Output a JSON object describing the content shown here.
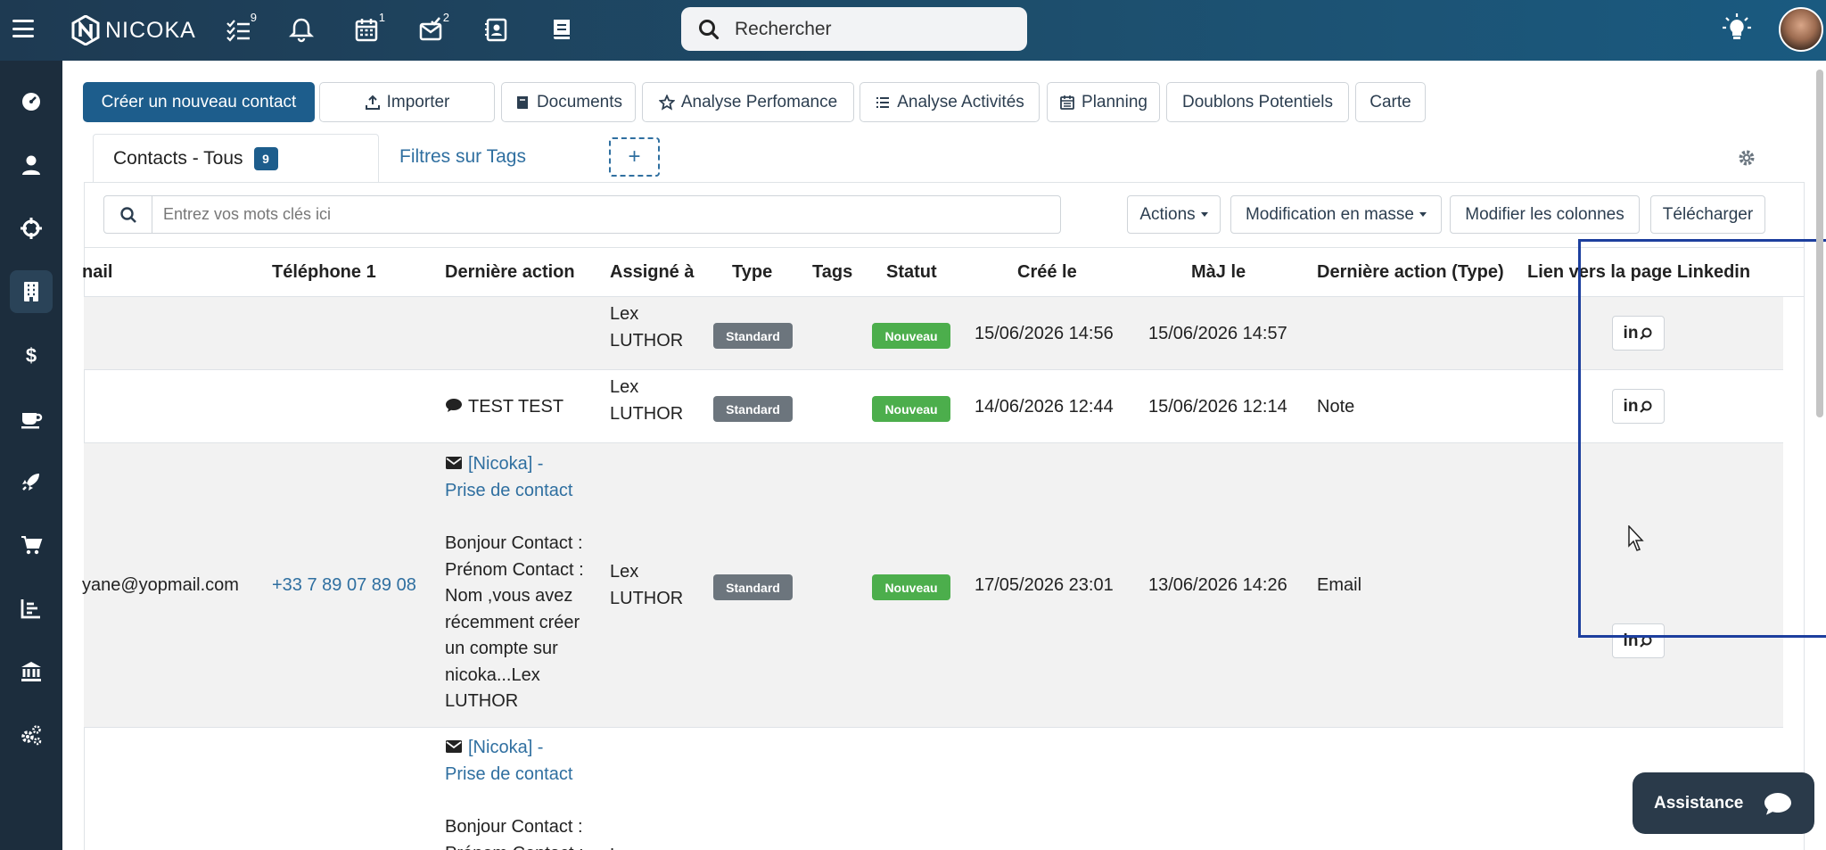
{
  "app": {
    "logo": "NICOKA"
  },
  "topbar": {
    "badges": {
      "tasks": "9",
      "calendar": "1",
      "mail": "2"
    },
    "search_label": "Rechercher"
  },
  "toolbar": {
    "create": "Créer un nouveau contact",
    "import": "Importer",
    "documents": "Documents",
    "analyse_perf": "Analyse Perfomance",
    "analyse_act": "Analyse Activités",
    "planning": "Planning",
    "doublons": "Doublons Potentiels",
    "carte": "Carte"
  },
  "tabs": {
    "active_label": "Contacts - Tous",
    "active_count": "9",
    "filters_label": "Filtres sur Tags",
    "add_label": "+"
  },
  "filter": {
    "placeholder": "Entrez vos mots clés ici",
    "actions": "Actions",
    "bulk": "Modification en masse",
    "columns": "Modifier les colonnes",
    "download": "Télécharger"
  },
  "table": {
    "headers": {
      "email": "nail",
      "phone": "Téléphone 1",
      "last_action": "Dernière action",
      "assigned": "Assigné à",
      "type": "Type",
      "tags": "Tags",
      "status": "Statut",
      "created": "Créé le",
      "updated": "MàJ le",
      "last_action_type": "Dernière action (Type)",
      "linkedin": "Lien vers la page Linkedin"
    },
    "rows": [
      {
        "email": "",
        "phone": "",
        "last_action": "",
        "assigned_1": "Lex",
        "assigned_2": "LUTHOR",
        "type": "Standard",
        "status": "Nouveau",
        "created": "15/06/2026 14:56",
        "updated": "15/06/2026 14:57",
        "action_type": "",
        "linkedin": "in"
      },
      {
        "email": "",
        "phone": "",
        "last_action": "TEST TEST",
        "assigned_1": "Lex",
        "assigned_2": "LUTHOR",
        "type": "Standard",
        "status": "Nouveau",
        "created": "14/06/2026 12:44",
        "updated": "15/06/2026 12:14",
        "action_type": "Note",
        "linkedin": "in"
      },
      {
        "email": "yane@yopmail.com",
        "phone": "+33 7 89 07 89 08",
        "last_action_subject_1": "[Nicoka] -",
        "last_action_subject_2": "Prise de contact",
        "last_action_body": [
          "Bonjour Contact :",
          "Prénom Contact :",
          "Nom ,vous avez",
          "récemment créer",
          "un compte sur",
          "nicoka...Lex",
          "LUTHOR"
        ],
        "assigned_1": "Lex",
        "assigned_2": "LUTHOR",
        "type": "Standard",
        "status": "Nouveau",
        "created": "17/05/2026 23:01",
        "updated": "13/06/2026 14:26",
        "action_type": "Email",
        "linkedin": "in"
      },
      {
        "last_action_subject_1": "[Nicoka] -",
        "last_action_subject_2": "Prise de contact",
        "last_action_body": [
          "Bonjour Contact :",
          "Prénom Contact :"
        ],
        "assigned_1": "Lex"
      }
    ]
  },
  "assistance": {
    "label": "Assistance"
  },
  "colors": {
    "topbar": "#1e3a52",
    "sidebar": "#1c2d3d",
    "primary": "#1d5d8c",
    "link": "#2f6fa0",
    "status_new": "#4cae4c",
    "type_standard": "#6c757d",
    "highlight_border": "#1d3f9e"
  },
  "icons": {
    "topbar": [
      "menu-icon",
      "tasks-icon",
      "bell-icon",
      "calendar-icon",
      "mail-check-icon",
      "address-book-icon",
      "book-icon",
      "search-icon",
      "lightbulb-icon"
    ],
    "sidebar": [
      "dashboard-icon",
      "user-icon",
      "crosshair-icon",
      "building-icon",
      "dollar-icon",
      "coffee-icon",
      "rocket-icon",
      "cart-icon",
      "chart-icon",
      "bank-icon",
      "cogs-icon"
    ]
  }
}
